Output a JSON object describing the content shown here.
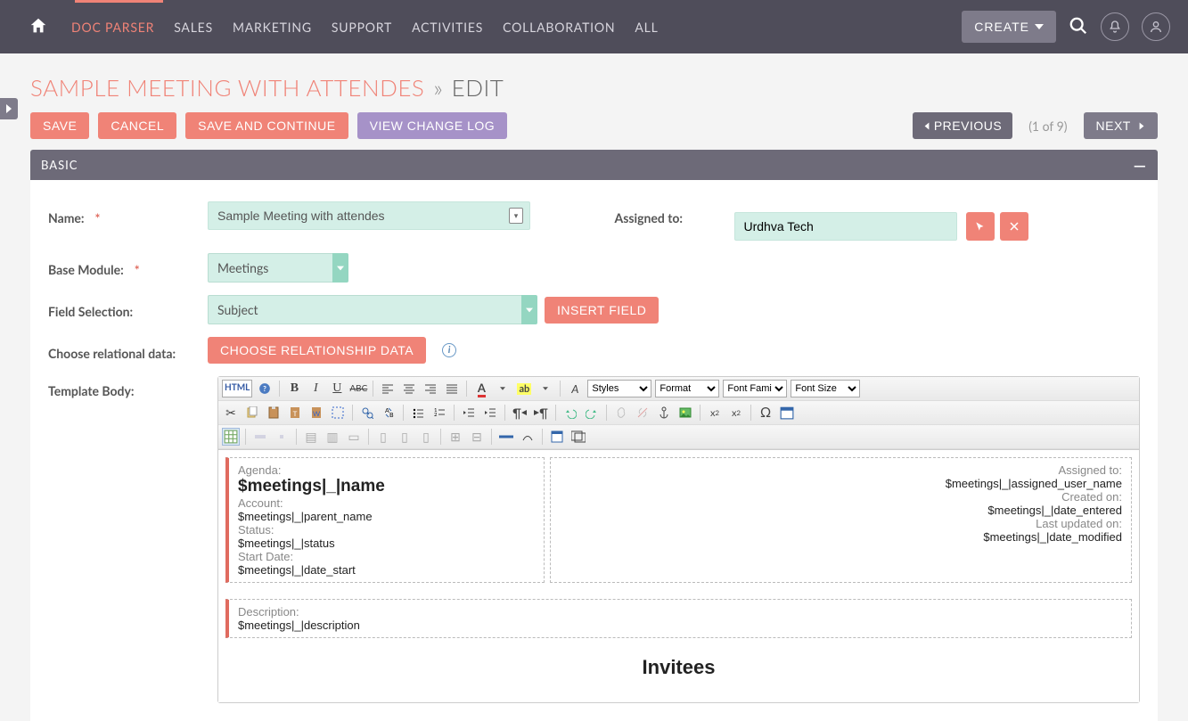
{
  "nav": {
    "items": [
      "DOC PARSER",
      "SALES",
      "MARKETING",
      "SUPPORT",
      "ACTIVITIES",
      "COLLABORATION",
      "ALL"
    ],
    "create_label": "CREATE"
  },
  "breadcrumb": {
    "title": "SAMPLE MEETING WITH ATTENDES",
    "sep": "»",
    "mode": "EDIT"
  },
  "actions": {
    "save": "SAVE",
    "cancel": "CANCEL",
    "save_continue": "SAVE AND CONTINUE",
    "view_log": "VIEW CHANGE LOG",
    "previous": "PREVIOUS",
    "next": "NEXT",
    "pager": "(1 of 9)"
  },
  "panel": {
    "title": "BASIC"
  },
  "form": {
    "name_label": "Name:",
    "name_value": "Sample Meeting with attendes",
    "assigned_label": "Assigned to:",
    "assigned_value": "Urdhva Tech",
    "base_module_label": "Base Module:",
    "base_module_value": "Meetings",
    "field_selection_label": "Field Selection:",
    "field_selection_value": "Subject",
    "insert_field": "INSERT FIELD",
    "choose_rel_label": "Choose relational data:",
    "choose_rel_btn": "CHOOSE RELATIONSHIP DATA",
    "template_body_label": "Template Body:"
  },
  "editor_toolbar": {
    "html": "HTML",
    "styles": "Styles",
    "format": "Format",
    "font_family": "Font Family",
    "font_size": "Font Size"
  },
  "template": {
    "left": {
      "agenda_label": "Agenda:",
      "agenda_val": "$meetings|_|name",
      "account_label": "Account:",
      "account_val": "$meetings|_|parent_name",
      "status_label": "Status:",
      "status_val": "$meetings|_|status",
      "start_label": "Start Date:",
      "start_val": "$meetings|_|date_start"
    },
    "right": {
      "assigned_label": "Assigned to:",
      "assigned_val": "$meetings|_|assigned_user_name",
      "created_label": "Created on:",
      "created_val": "$meetings|_|date_entered",
      "updated_label": "Last updated on:",
      "updated_val": "$meetings|_|date_modified"
    },
    "desc_label": "Description:",
    "desc_val": "$meetings|_|description",
    "invitees": "Invitees"
  }
}
